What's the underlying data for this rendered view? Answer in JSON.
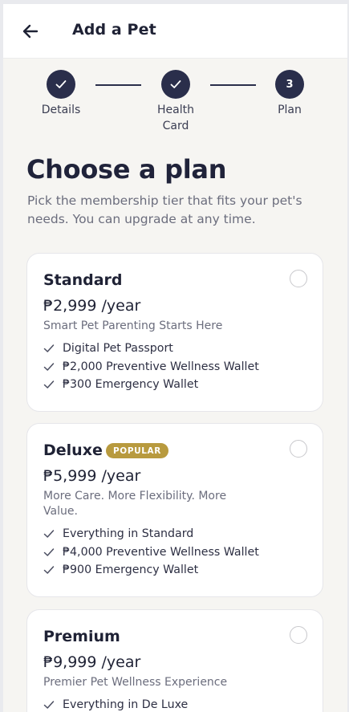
{
  "header": {
    "title": "Add a Pet"
  },
  "steps": [
    {
      "label": "Details",
      "label2": "",
      "status": "done",
      "number": ""
    },
    {
      "label": "Health",
      "label2": "Card",
      "status": "done",
      "number": ""
    },
    {
      "label": "Plan",
      "label2": "",
      "status": "current",
      "number": "3"
    }
  ],
  "main": {
    "title": "Choose a plan",
    "subtitle": "Pick the membership tier that fits your pet's needs. You can upgrade at any time."
  },
  "plans": [
    {
      "name": "Standard",
      "badge": "",
      "price": "₱2,999 /year",
      "tagline": "Smart Pet Parenting Starts Here",
      "features": [
        "Digital Pet Passport",
        "₱2,000 Preventive Wellness Wallet",
        "₱300 Emergency Wallet"
      ]
    },
    {
      "name": "Deluxe",
      "badge": "POPULAR",
      "price": "₱5,999 /year",
      "tagline": "More Care. More Flexibility. More Value.",
      "features": [
        "Everything in Standard",
        "₱4,000 Preventive Wellness Wallet",
        "₱900 Emergency Wallet"
      ]
    },
    {
      "name": "Premium",
      "badge": "",
      "price": "₱9,999 /year",
      "tagline": "Premier Pet Wellness Experience",
      "features": [
        "Everything in De Luxe"
      ]
    }
  ],
  "colors": {
    "primary": "#2a2e4b",
    "badge": "#b89a3e",
    "background": "#f6f5f2"
  }
}
